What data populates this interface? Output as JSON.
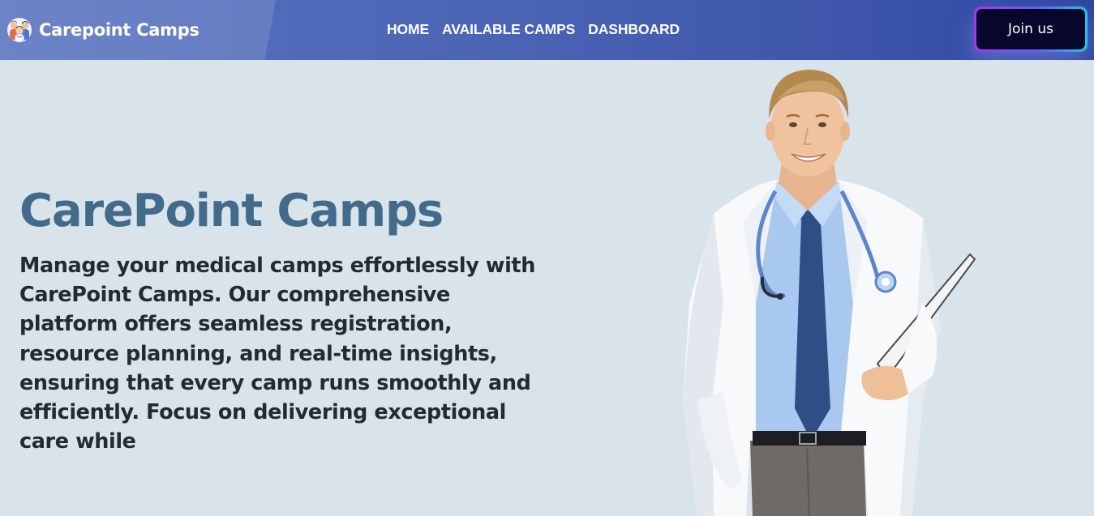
{
  "navbar": {
    "brand_name": "Carepoint Camps",
    "logo_icon": "doctors-group-icon",
    "links": [
      {
        "label": "HOME"
      },
      {
        "label": "AVAILABLE CAMPS"
      },
      {
        "label": "DASHBOARD"
      }
    ],
    "join_label": "Join us"
  },
  "hero": {
    "title": "CarePoint Camps",
    "description": "Manage your medical camps effortlessly with CarePoint Camps. Our comprehensive platform offers seamless registration, resource planning, and real-time insights, ensuring that every camp runs smoothly and efficiently. Focus on delivering exceptional care while",
    "image_subject": "smiling doctor in white coat with stethoscope holding clipboard"
  },
  "colors": {
    "navbar_start": "#5872c0",
    "navbar_end": "#2e47a1",
    "page_background": "#d9e3ea",
    "title": "#426a8b",
    "body_text": "#202b35",
    "button_background": "#07062b",
    "button_border_start": "#a336f5",
    "button_border_end": "#21c4e6"
  }
}
